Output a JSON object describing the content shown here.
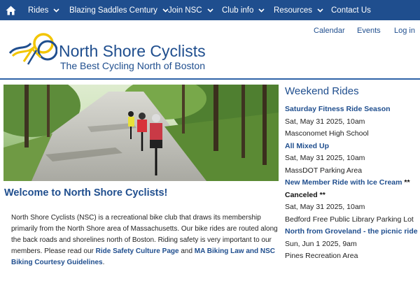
{
  "nav": {
    "home_icon": "home-icon",
    "items": [
      {
        "label": "Rides",
        "has_dropdown": true
      },
      {
        "label": "Blazing Saddles Century",
        "has_dropdown": true
      },
      {
        "label": "Join NSC",
        "has_dropdown": true
      },
      {
        "label": "Club info",
        "has_dropdown": true
      },
      {
        "label": "Resources",
        "has_dropdown": true
      },
      {
        "label": "Contact Us",
        "has_dropdown": false
      }
    ]
  },
  "utility_links": [
    "Calendar",
    "Events",
    "Log in"
  ],
  "header": {
    "title": "North Shore Cyclists",
    "tagline": "The Best Cycling North of Boston"
  },
  "main": {
    "welcome_heading": "Welcome to North Shore Cyclists!",
    "intro": {
      "text_1": "North Shore Cyclists (NSC) is a recreational bike club that draws its membership primarily from the North Shore area of Massachusetts. Our bike rides are routed along the back roads and shorelines north of Boston. Riding safety is very important to our members.  Please read our ",
      "link_1": "Ride Safety Culture Page",
      "text_2": " and ",
      "link_2": "MA Biking Law and NSC Biking Courtesy Guidelines",
      "text_3": "."
    }
  },
  "sidebar": {
    "heading": "Weekend Rides",
    "rides": [
      {
        "title": "Saturday Fitness Ride Season",
        "note": "",
        "date": "Sat, May 31 2025, 10am",
        "location": "Masconomet High School"
      },
      {
        "title": "All Mixed Up",
        "note": "",
        "date": "Sat, May 31 2025, 10am",
        "location": "MassDOT Parking Area"
      },
      {
        "title": "New Member Ride with Ice Cream",
        "note": "** Canceled **",
        "date": "Sat, May 31 2025, 10am",
        "location": "Bedford Free Public Library Parking Lot"
      },
      {
        "title": "North from Groveland - the picnic ride",
        "note": "",
        "date": "Sun, Jun 1 2025, 9am",
        "location": "Pines Recreation Area"
      }
    ]
  },
  "colors": {
    "brand_blue": "#1f4e8e",
    "nav_background": "#1f4e8e",
    "logo_yellow": "#f2c500"
  }
}
